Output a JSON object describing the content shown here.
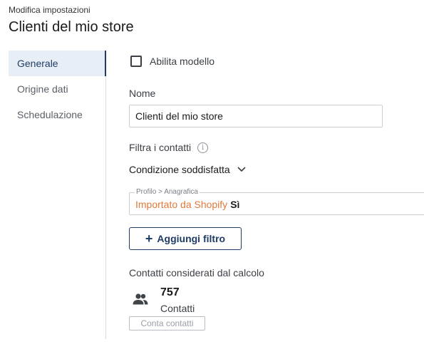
{
  "header": {
    "breadcrumb": "Modifica impostazioni",
    "title": "Clienti del mio store"
  },
  "sidebar": {
    "items": [
      {
        "label": "Generale",
        "active": true
      },
      {
        "label": "Origine dati",
        "active": false
      },
      {
        "label": "Schedulazione",
        "active": false
      }
    ]
  },
  "form": {
    "enable_label": "Abilita modello",
    "enable_checked": false,
    "name_label": "Nome",
    "name_value": "Clienti del mio store",
    "filter_label": "Filtra i contatti",
    "info_icon": "info-icon",
    "condition_label": "Condizione soddisfatta",
    "filter": {
      "path": "Profilo > Anagrafica",
      "source": "Importato da Shopify",
      "value": "Sì"
    },
    "add_filter_label": "Aggiungi filtro",
    "contacts_label": "Contatti considerati dal calcolo",
    "contacts_count": "757",
    "contacts_unit": "Contatti",
    "count_button_label": "Conta contatti"
  },
  "colors": {
    "accent": "#1f3c66",
    "filter_source": "#e07a3a",
    "active_nav_bg": "#e8eef5"
  }
}
